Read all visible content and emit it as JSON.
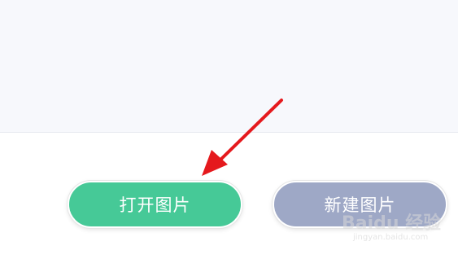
{
  "buttons": {
    "open_image": "打开图片",
    "new_image": "新建图片"
  },
  "watermark": {
    "main": "Baidu 经验",
    "sub": "jingyan.baidu.com"
  },
  "colors": {
    "open_button": "#46c997",
    "new_button": "#9ea8c6",
    "arrow": "#e5191d",
    "panel_background": "#f7f8fc"
  },
  "icons": {
    "annotation_arrow": "arrow-icon"
  }
}
